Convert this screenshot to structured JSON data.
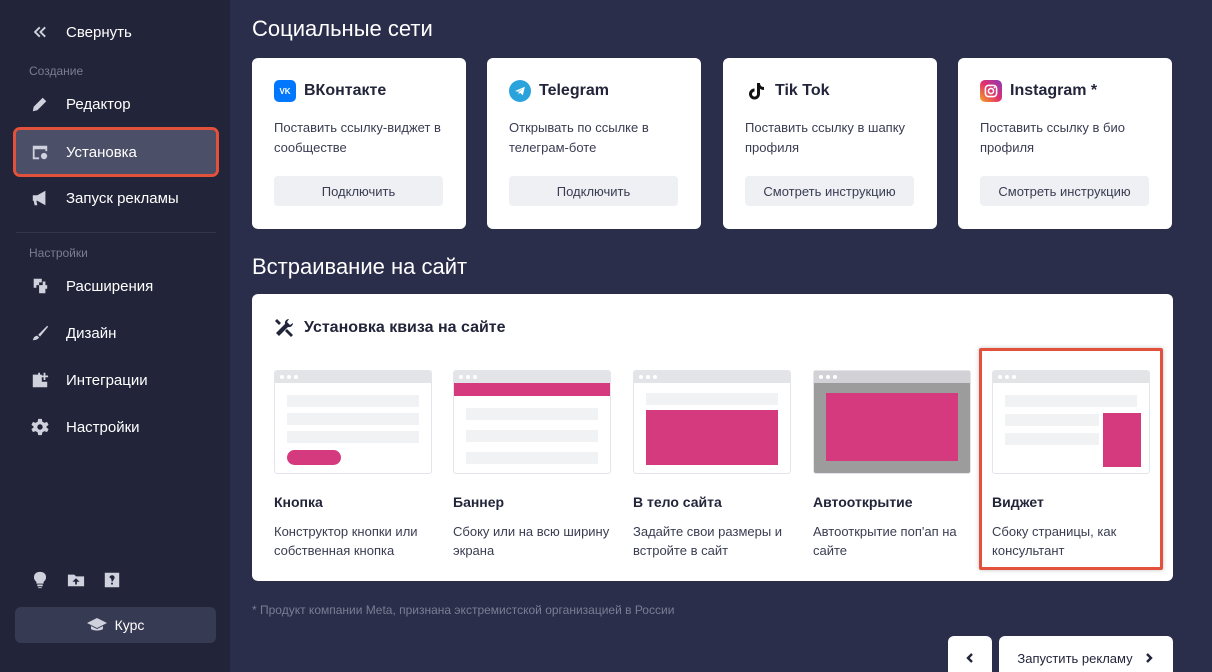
{
  "sidebar": {
    "collapse_label": "Свернуть",
    "section_create": "Создание",
    "section_settings": "Настройки",
    "items": [
      {
        "label": "Редактор"
      },
      {
        "label": "Установка"
      },
      {
        "label": "Запуск рекламы"
      },
      {
        "label": "Расширения"
      },
      {
        "label": "Дизайн"
      },
      {
        "label": "Интеграции"
      },
      {
        "label": "Настройки"
      }
    ],
    "course_label": "Курс"
  },
  "social": {
    "title": "Социальные сети",
    "cards": [
      {
        "name": "ВКонтакте",
        "desc": "Поставить ссылку-виджет в сообществе",
        "button": "Подключить"
      },
      {
        "name": "Telegram",
        "desc": "Открывать по ссылке в телеграм-боте",
        "button": "Подключить"
      },
      {
        "name": "Tik Tok",
        "desc": "Поставить ссылку в шапку профиля",
        "button": "Смотреть инструкцию"
      },
      {
        "name": "Instagram *",
        "desc": "Поставить ссылку в био профиля",
        "button": "Смотреть инструкцию"
      }
    ]
  },
  "embed": {
    "title": "Встраивание на сайт",
    "panel_title": "Установка квиза на сайте",
    "options": [
      {
        "title": "Кнопка",
        "desc": "Конструктор кнопки или собственная кнопка"
      },
      {
        "title": "Баннер",
        "desc": "Сбоку или на всю ширину экрана"
      },
      {
        "title": "В тело сайта",
        "desc": "Задайте свои размеры и встройте в сайт"
      },
      {
        "title": "Автооткрытие",
        "desc": "Автооткрытие поп'ап на сайте"
      },
      {
        "title": "Виджет",
        "desc": "Сбоку страницы, как консультант"
      }
    ]
  },
  "footnote": "* Продукт компании Meta, признана экстремистской организацией в России",
  "nav": {
    "next_label": "Запустить рекламу"
  },
  "colors": {
    "accent": "#d63a7e",
    "highlight": "#e2513b",
    "sidebar_bg": "#222539",
    "main_bg": "#2b2e4a"
  }
}
